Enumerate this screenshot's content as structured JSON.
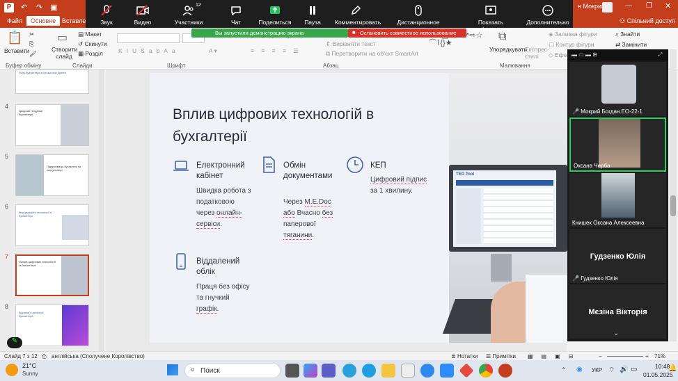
{
  "ppt": {
    "menu": {
      "file": "Файл",
      "home": "Основне",
      "insert": "Вставлен"
    },
    "user_name": "н Мокрий",
    "share_label": "Спільний доступ",
    "ribbon": {
      "paste": "Вставити",
      "create_slide": "Створити слайд",
      "layout": "Макет",
      "reset": "Скинути",
      "section": "Розділ",
      "clipboard_group": "Буфер обміну",
      "slides_group": "Слайди",
      "font_group": "Шрифт",
      "paragraph_group": "Абзац",
      "drawing_group": "Малювання",
      "vertical_text": "Вирівняти текст",
      "smartart": "Перетворити на об'єкт SmartArt",
      "arrange": "Упорядкувати",
      "quick_styles": "Експрес-стилі",
      "shape_fill": "Заливка фігури",
      "shape_outline": "Контур фігури",
      "shape_effects": "Ефе",
      "find": "Знайти",
      "replace": "Замінити"
    },
    "status": {
      "slide": "Слайд 7 з 12",
      "language": "англійська (Сполучене Королівство)",
      "notes": "Нотатки",
      "comments": "Примітки",
      "zoom": "71%"
    }
  },
  "zoom": {
    "participants_count": "12",
    "tools": [
      {
        "label": "Звук"
      },
      {
        "label": "Видео"
      },
      {
        "label": "Участники"
      },
      {
        "label": "Чат"
      },
      {
        "label": "Поделиться"
      },
      {
        "label": "Пауза"
      },
      {
        "label": "Комментировать"
      },
      {
        "label": "Дистанционное управление"
      },
      {
        "label": "Показать конференцию"
      },
      {
        "label": "Дополнительно"
      }
    ],
    "share_banner": "Вы запустили демонстрацию экрана",
    "stop_share": "Остановить совместное использование",
    "gallery": [
      {
        "name": "Мокрий Богдан ЕО-22-1"
      },
      {
        "name": "Оксана Черба"
      },
      {
        "name": "Книшек Оксана Алексеевна"
      },
      {
        "name": "Гудзенко Юлія",
        "big": "Гудзенко Юлія"
      },
      {
        "name": "",
        "big": "Мєзіна Вікторія"
      }
    ]
  },
  "thumbnails": [
    {
      "num": "",
      "title": "Роль бухгалтера в сучасному бізнесі"
    },
    {
      "num": "4",
      "title": "Цифрові тенденції бухгалтерії"
    },
    {
      "num": "5",
      "title": "Підприємець-бухгалтер та консультації"
    },
    {
      "num": "6",
      "title": "Інформаційні технології в бухгалтерії"
    },
    {
      "num": "7",
      "title": "Вплив цифрових технологій в бухгалтерії"
    },
    {
      "num": "8",
      "title": "Виклики у професії бухгалтера"
    }
  ],
  "slide": {
    "title": "Вплив цифрових технологій в бухгалтерії",
    "features": [
      {
        "head": "Електронний кабінет",
        "body": "Швидка робота з податковою через онлайн-сервіси."
      },
      {
        "head": "Обмін документами",
        "body": "Через M.E.Doc або Вчасно без паперової тяганини."
      },
      {
        "head": "КЕП",
        "body": "Цифровий підпис за 1 хвилину."
      },
      {
        "head": "Віддалений облік",
        "body": "Праця без офісу та гнучкий графік."
      }
    ],
    "photo_brand": "TEO Tool"
  },
  "taskbar": {
    "weather_temp": "21°C",
    "weather_desc": "Sunny",
    "search_placeholder": "Поиск",
    "lang": "УКР",
    "time": "10:48",
    "date": "01.05.2025"
  },
  "colors": {
    "ppt_accent": "#c43e1c",
    "zoom_green": "#3aa54a",
    "zoom_red": "#d4342a",
    "slide_icon": "#3b64b5"
  }
}
